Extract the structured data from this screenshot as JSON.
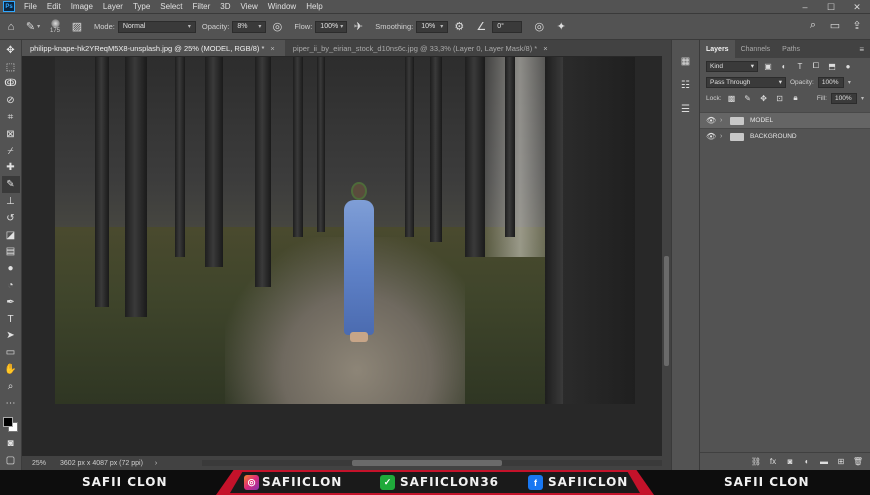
{
  "app": {
    "logo": "Ps"
  },
  "menu": [
    "File",
    "Edit",
    "Image",
    "Layer",
    "Type",
    "Select",
    "Filter",
    "3D",
    "View",
    "Window",
    "Help"
  ],
  "window_controls": [
    "–",
    "☐",
    "✕"
  ],
  "options": {
    "brush_size": "175",
    "mode_label": "Mode:",
    "mode_value": "Normal",
    "opacity_label": "Opacity:",
    "opacity_value": "8%",
    "flow_label": "Flow:",
    "flow_value": "100%",
    "smoothing_label": "Smoothing:",
    "smoothing_value": "10%",
    "angle_value": "0°"
  },
  "tabs": [
    {
      "label": "philipp-knape-hk2YReqM5X8-unsplash.jpg @ 25% (MODEL, RGB/8) *",
      "active": true
    },
    {
      "label": "piper_ii_by_eirian_stock_d10ns6c.jpg @ 33,3% (Layer 0, Layer Mask/8) *",
      "active": false
    }
  ],
  "status": {
    "zoom": "25%",
    "dims": "3602 px x 4087 px (72 ppi)"
  },
  "panel": {
    "tabs": [
      "Layers",
      "Channels",
      "Paths"
    ],
    "filter_kind": "Kind",
    "blend_mode": "Pass Through",
    "opacity_label": "Opacity:",
    "opacity_value": "100%",
    "lock_label": "Lock:",
    "fill_label": "Fill:",
    "fill_value": "100%",
    "layers": [
      {
        "name": "MODEL",
        "selected": true
      },
      {
        "name": "BACKGROUND",
        "selected": false
      }
    ]
  },
  "banner": {
    "left": "SAFII CLON",
    "instagram": "SAFIICLON",
    "other": "SAFIICLON36",
    "facebook": "SAFIICLON",
    "right": "SAFII CLON",
    "accent": "#c4122a"
  }
}
